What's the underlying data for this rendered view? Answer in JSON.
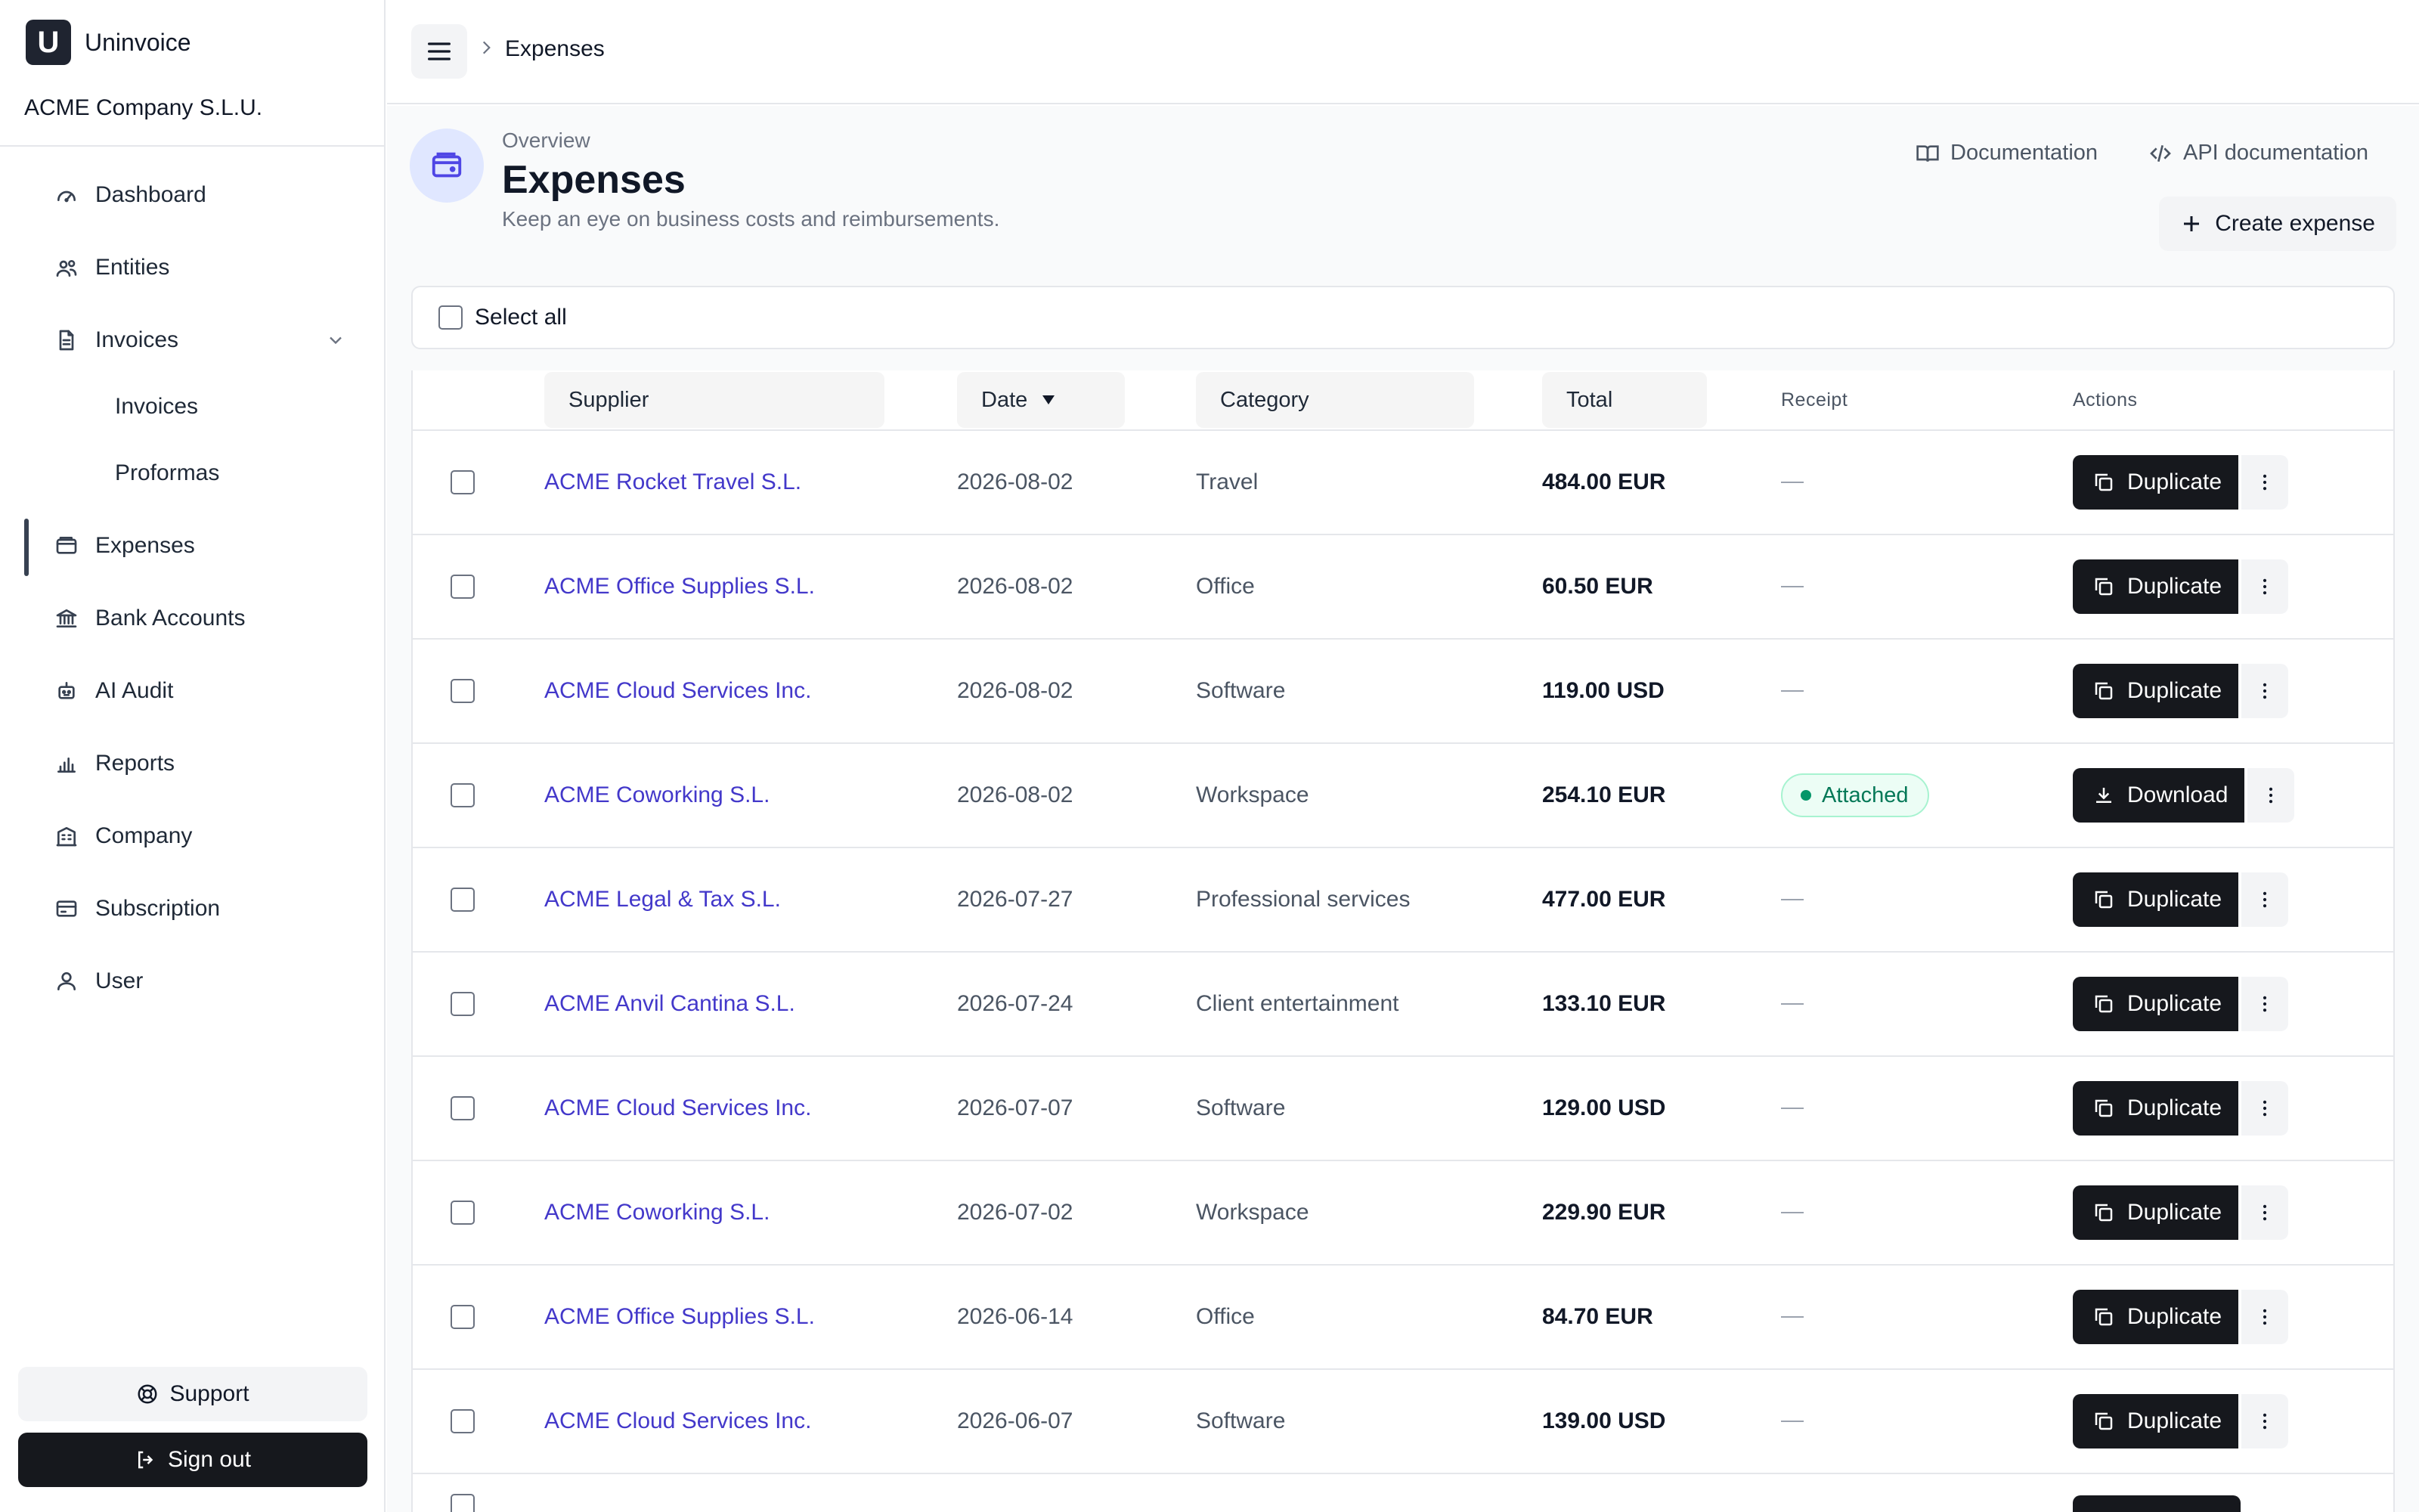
{
  "app": {
    "name": "Uninvoice",
    "logo_letter": "U",
    "company": "ACME Company S.L.U."
  },
  "sidebar": {
    "items": [
      {
        "label": "Dashboard",
        "icon": "gauge-icon"
      },
      {
        "label": "Entities",
        "icon": "users-icon"
      },
      {
        "label": "Invoices",
        "icon": "document-icon",
        "expanded": true
      },
      {
        "label": "Invoices",
        "sub": true
      },
      {
        "label": "Proformas",
        "sub": true
      },
      {
        "label": "Expenses",
        "icon": "wallet-icon",
        "active": true
      },
      {
        "label": "Bank Accounts",
        "icon": "bank-icon"
      },
      {
        "label": "AI Audit",
        "icon": "robot-icon"
      },
      {
        "label": "Reports",
        "icon": "bar-chart-icon"
      },
      {
        "label": "Company",
        "icon": "building-icon"
      },
      {
        "label": "Subscription",
        "icon": "credit-card-icon"
      },
      {
        "label": "User",
        "icon": "user-icon"
      }
    ],
    "support_label": "Support",
    "signout_label": "Sign out"
  },
  "topbar": {
    "breadcrumb": "Expenses"
  },
  "header": {
    "overview": "Overview",
    "title": "Expenses",
    "subtitle": "Keep an eye on business costs and reimbursements.",
    "documentation": "Documentation",
    "api_documentation": "API documentation",
    "create_label": "Create expense"
  },
  "table": {
    "select_all": "Select all",
    "columns": {
      "supplier": "Supplier",
      "date": "Date",
      "category": "Category",
      "total": "Total",
      "receipt": "Receipt",
      "actions": "Actions"
    },
    "sort": {
      "column": "Date",
      "direction": "descending"
    },
    "rows": [
      {
        "supplier": "ACME Rocket Travel S.L.",
        "date": "2026-08-02",
        "category": "Travel",
        "total": "484.00 EUR",
        "receipt": "—",
        "action": "Duplicate"
      },
      {
        "supplier": "ACME Office Supplies S.L.",
        "date": "2026-08-02",
        "category": "Office",
        "total": "60.50 EUR",
        "receipt": "—",
        "action": "Duplicate"
      },
      {
        "supplier": "ACME Cloud Services Inc.",
        "date": "2026-08-02",
        "category": "Software",
        "total": "119.00 USD",
        "receipt": "—",
        "action": "Duplicate"
      },
      {
        "supplier": "ACME Coworking S.L.",
        "date": "2026-08-02",
        "category": "Workspace",
        "total": "254.10 EUR",
        "receipt": "Attached",
        "action": "Download"
      },
      {
        "supplier": "ACME Legal & Tax S.L.",
        "date": "2026-07-27",
        "category": "Professional services",
        "total": "477.00 EUR",
        "receipt": "—",
        "action": "Duplicate"
      },
      {
        "supplier": "ACME Anvil Cantina S.L.",
        "date": "2026-07-24",
        "category": "Client entertainment",
        "total": "133.10 EUR",
        "receipt": "—",
        "action": "Duplicate"
      },
      {
        "supplier": "ACME Cloud Services Inc.",
        "date": "2026-07-07",
        "category": "Software",
        "total": "129.00 USD",
        "receipt": "—",
        "action": "Duplicate"
      },
      {
        "supplier": "ACME Coworking S.L.",
        "date": "2026-07-02",
        "category": "Workspace",
        "total": "229.90 EUR",
        "receipt": "—",
        "action": "Duplicate"
      },
      {
        "supplier": "ACME Office Supplies S.L.",
        "date": "2026-06-14",
        "category": "Office",
        "total": "84.70 EUR",
        "receipt": "—",
        "action": "Duplicate"
      },
      {
        "supplier": "ACME Cloud Services Inc.",
        "date": "2026-06-07",
        "category": "Software",
        "total": "139.00 USD",
        "receipt": "—",
        "action": "Duplicate"
      }
    ]
  },
  "colors": {
    "accent": "#4338ca",
    "dark": "#16181d",
    "success": "#047857"
  }
}
